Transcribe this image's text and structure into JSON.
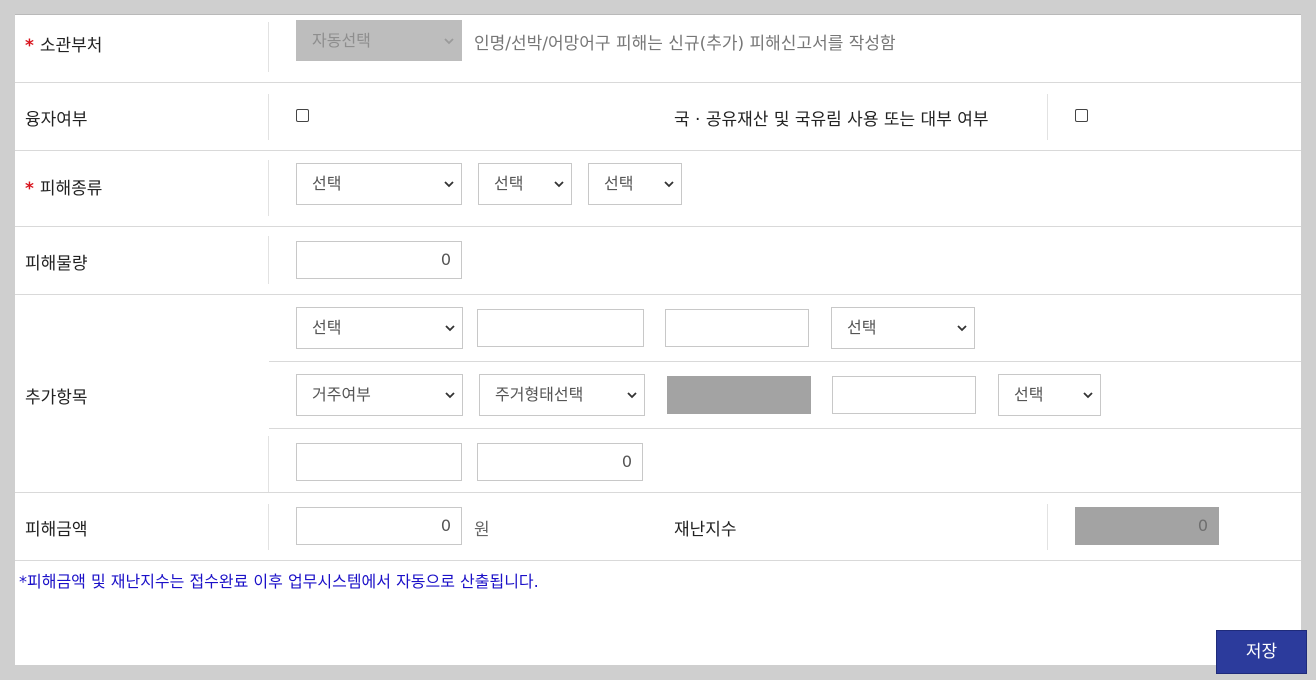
{
  "rows": {
    "agency": {
      "required_mark": "*",
      "label": "소관부처",
      "select_value": "자동선택",
      "hint": "인명/선박/어망어구 피해는 신규(추가) 피해신고서를 작성함"
    },
    "loan": {
      "label": "융자여부",
      "public_property_label": "국 · 공유재산 및 국유림 사용 또는 대부 여부"
    },
    "damage_type": {
      "required_mark": "*",
      "label": "피해종류",
      "select1": "선택",
      "select2": "선택",
      "select3": "선택"
    },
    "damage_qty": {
      "label": "피해물량",
      "value": "0"
    },
    "extra": {
      "label": "추가항목",
      "line1": {
        "select_a": "선택",
        "input_a": "",
        "input_b": "",
        "select_b": "선택"
      },
      "line2": {
        "residence_select": "거주여부",
        "housing_select": "주거형태선택",
        "gray_field": "",
        "input_c": "",
        "select_c": "선택"
      },
      "line3": {
        "input_d": "",
        "input_e": "0"
      }
    },
    "damage_amount": {
      "label": "피해금액",
      "value": "0",
      "unit": "원",
      "index_label": "재난지수",
      "index_value": "0"
    }
  },
  "note": "*피해금액 및 재난지수는 접수완료 이후 업무시스템에서 자동으로 산출됩니다.",
  "save_button": "저장",
  "colors": {
    "required": "#d8141e",
    "note": "#1b10c8",
    "save_button_bg": "#2c3b9c"
  }
}
